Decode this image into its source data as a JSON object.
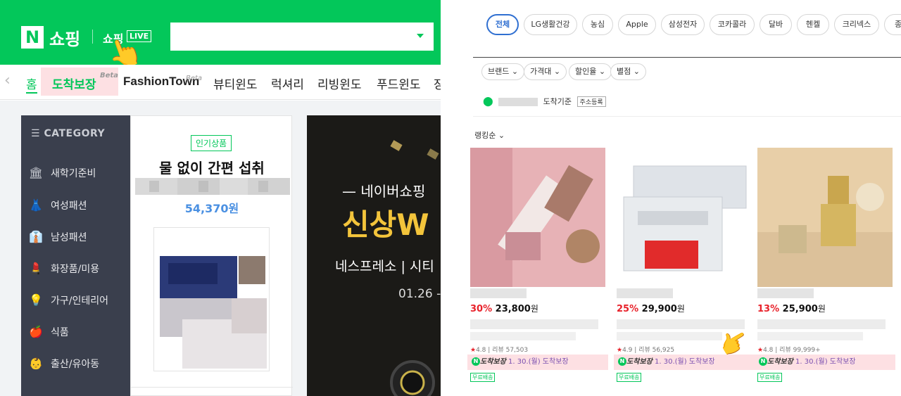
{
  "left": {
    "header": {
      "logo_letter": "N",
      "title": "쇼핑",
      "live_text": "쇼핑",
      "live_badge": "LIVE",
      "search_placeholder": ""
    },
    "nav": {
      "items": [
        {
          "label": "홈"
        },
        {
          "label": "도착보장"
        },
        {
          "label": "FashionTown"
        },
        {
          "label": "뷰티윈도"
        },
        {
          "label": "럭셔리"
        },
        {
          "label": "리빙윈도"
        },
        {
          "label": "푸드윈도"
        },
        {
          "label": "장"
        }
      ],
      "beta": "Beta"
    },
    "category": {
      "heading": "CATEGORY",
      "items": [
        {
          "label": "새학기준비",
          "icon": "school-icon"
        },
        {
          "label": "여성패션",
          "icon": "dress-icon"
        },
        {
          "label": "남성패션",
          "icon": "shirt-icon"
        },
        {
          "label": "화장품/미용",
          "icon": "cosmetic-icon"
        },
        {
          "label": "가구/인테리어",
          "icon": "lamp-icon"
        },
        {
          "label": "식품",
          "icon": "apple-icon"
        },
        {
          "label": "출산/유아동",
          "icon": "baby-icon"
        }
      ]
    },
    "product": {
      "badge": "인기상품",
      "title": "물 없이 간편 섭취",
      "price": "54,370원"
    },
    "banner": {
      "line1": "— 네이버쇼핑",
      "line2a": "신상",
      "line2b": "W",
      "line3": "네스프레소 | 시티",
      "line4": "01.26 -"
    }
  },
  "right": {
    "chips": [
      "전체",
      "LG생활건강",
      "농심",
      "Apple",
      "삼성전자",
      "코카콜라",
      "달바",
      "헨켈",
      "크리넥스",
      "종"
    ],
    "filters": [
      "브랜드",
      "가격대",
      "할인율",
      "별점"
    ],
    "location": {
      "suffix": "도착기준",
      "register": "주소등록"
    },
    "sort": "랭킹순",
    "products": [
      {
        "pct": "30",
        "price": "23,800",
        "won": "원",
        "rating": "4.8",
        "reviews": "리뷰 57,503",
        "arrive_label": "도착보장",
        "arrive_date": "1. 30.(월) 도착보장",
        "free": "무료배송"
      },
      {
        "pct": "25",
        "price": "29,900",
        "won": "원",
        "rating": "4.9",
        "reviews": "리뷰 56,925",
        "arrive_label": "도착보장",
        "arrive_date": "1. 30.(월) 도착보장",
        "free": "무료배송"
      },
      {
        "pct": "13",
        "price": "25,900",
        "won": "원",
        "rating": "4.8",
        "reviews": "리뷰 99,999+",
        "arrive_label": "도착보장",
        "arrive_date": "1. 30.(월) 도착보장",
        "free": "무료배송"
      }
    ]
  },
  "colors": {
    "naver_green": "#03c75a",
    "highlight_pink": "#fde0e3",
    "discount_red": "#e8222b",
    "sidebar_dark": "#3a3f4d",
    "active_chip_blue": "#2f6fd1"
  }
}
